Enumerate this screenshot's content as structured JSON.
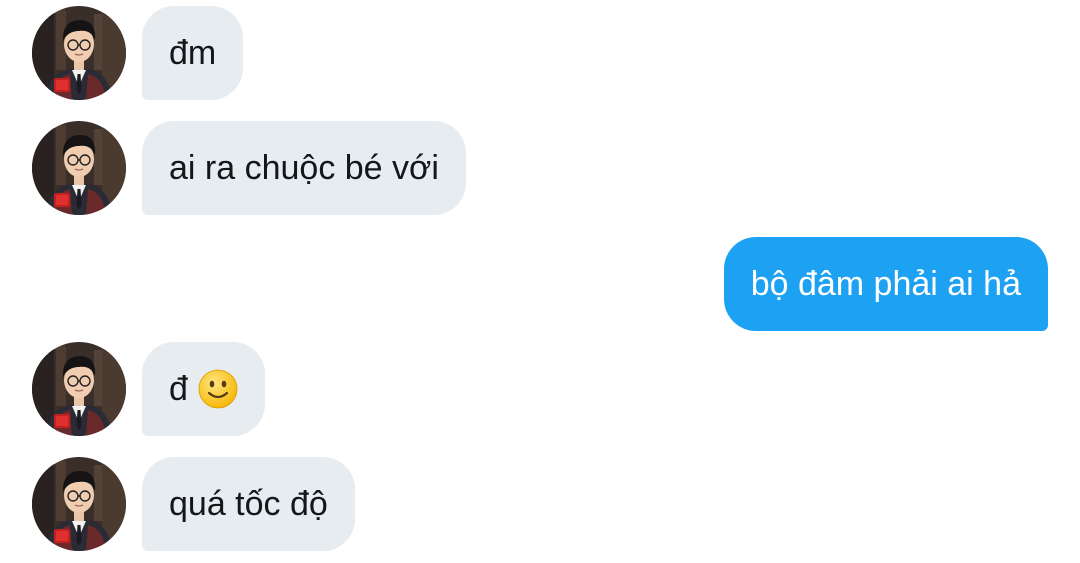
{
  "messages": [
    {
      "sender": "other",
      "text": "đm"
    },
    {
      "sender": "other",
      "text": "ai ra chuộc bé với"
    },
    {
      "sender": "me",
      "text": "bộ đâm phải ai hả"
    },
    {
      "sender": "other",
      "text": "đ",
      "emoji": "slightly-smiling-face-icon"
    },
    {
      "sender": "other",
      "text": "quá tốc độ"
    }
  ],
  "colors": {
    "incoming_bubble": "#e6ecf0",
    "outgoing_bubble": "#1da1f2",
    "incoming_text": "#14171a",
    "outgoing_text": "#ffffff"
  }
}
